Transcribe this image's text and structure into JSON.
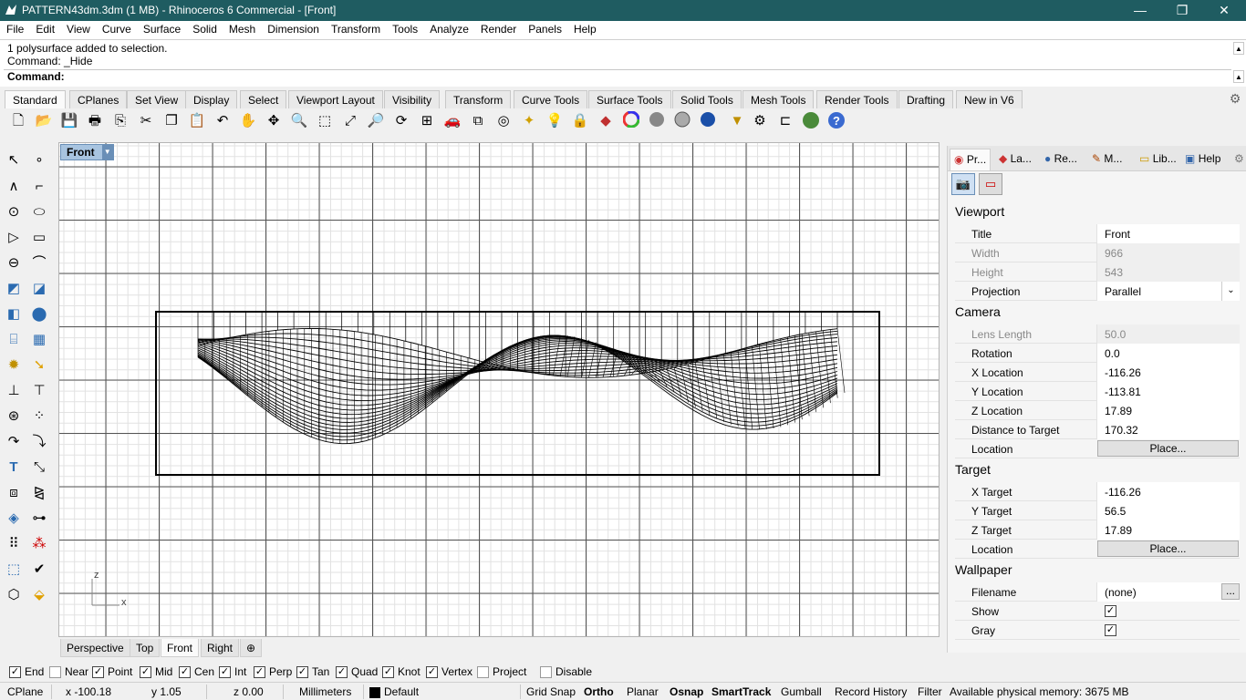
{
  "window": {
    "title": "PATTERN43dm.3dm (1 MB) - Rhinoceros 6 Commercial - [Front]",
    "controls": [
      "—",
      "❐",
      "✕"
    ]
  },
  "menu": [
    "File",
    "Edit",
    "View",
    "Curve",
    "Surface",
    "Solid",
    "Mesh",
    "Dimension",
    "Transform",
    "Tools",
    "Analyze",
    "Render",
    "Panels",
    "Help"
  ],
  "command": {
    "history": [
      "1 polysurface added to selection.",
      "Command: _Hide"
    ],
    "prompt": "Command:"
  },
  "toolbar_tabs": [
    "Standard",
    "CPlanes",
    "Set View",
    "Display",
    "Select",
    "Viewport Layout",
    "Visibility",
    "Transform",
    "Curve Tools",
    "Surface Tools",
    "Solid Tools",
    "Mesh Tools",
    "Render Tools",
    "Drafting",
    "New in V6"
  ],
  "toolbar_icons": [
    "new-file-icon",
    "open-folder-icon",
    "save-icon",
    "print-icon",
    "import-icon",
    "cut-icon",
    "copy-icon",
    "paste-icon",
    "undo-icon",
    "pan-hand-icon",
    "rotate-view-icon",
    "zoom-icon",
    "zoom-window-icon",
    "zoom-extents-icon",
    "zoom-selected-icon",
    "rotate-camera-icon",
    "four-viewports-icon",
    "car-icon",
    "layer-icon",
    "circle-target-icon",
    "lights-icon",
    "bulb-icon",
    "lock-icon",
    "layer-color-icon",
    "color-wheel-icon",
    "sphere-gray-icon",
    "sphere-shaded-icon",
    "sphere-dark-icon",
    "sphere-blue-icon",
    "filter-icon",
    "gears-icon",
    "dimension-icon",
    "render-globe-icon",
    "help-icon"
  ],
  "viewport": {
    "name": "Front",
    "axis_x": "x",
    "axis_z": "z"
  },
  "viewport_tabs": [
    "Perspective",
    "Top",
    "Front",
    "Right",
    "⊕"
  ],
  "right_panel": {
    "tabs": [
      "Pr...",
      "La...",
      "Re...",
      "M...",
      "Lib...",
      "Help"
    ],
    "sections": {
      "viewport_header": "Viewport",
      "camera_header": "Camera",
      "target_header": "Target",
      "wallpaper_header": "Wallpaper"
    },
    "viewport": {
      "title_label": "Title",
      "title_value": "Front",
      "width_label": "Width",
      "width_value": "966",
      "height_label": "Height",
      "height_value": "543",
      "projection_label": "Projection",
      "projection_value": "Parallel"
    },
    "camera": {
      "lens_label": "Lens Length",
      "lens_value": "50.0",
      "rotation_label": "Rotation",
      "rotation_value": "0.0",
      "xloc_label": "X Location",
      "xloc_value": "-116.26",
      "yloc_label": "Y Location",
      "yloc_value": "-113.81",
      "zloc_label": "Z Location",
      "zloc_value": "17.89",
      "dist_label": "Distance to Target",
      "dist_value": "170.32",
      "location_label": "Location",
      "location_button": "Place..."
    },
    "target": {
      "x_label": "X Target",
      "x_value": "-116.26",
      "y_label": "Y Target",
      "y_value": "56.5",
      "z_label": "Z Target",
      "z_value": "17.89",
      "location_label": "Location",
      "location_button": "Place..."
    },
    "wallpaper": {
      "filename_label": "Filename",
      "filename_value": "(none)",
      "filename_button": "...",
      "show_label": "Show",
      "show_checked": true,
      "gray_label": "Gray",
      "gray_checked": true
    }
  },
  "osnaps": [
    {
      "label": "End",
      "checked": true
    },
    {
      "label": "Near",
      "checked": false
    },
    {
      "label": "Point",
      "checked": true
    },
    {
      "label": "Mid",
      "checked": true
    },
    {
      "label": "Cen",
      "checked": true
    },
    {
      "label": "Int",
      "checked": true
    },
    {
      "label": "Perp",
      "checked": true
    },
    {
      "label": "Tan",
      "checked": true
    },
    {
      "label": "Quad",
      "checked": true
    },
    {
      "label": "Knot",
      "checked": true
    },
    {
      "label": "Vertex",
      "checked": true
    },
    {
      "label": "Project",
      "checked": false
    },
    {
      "label": "Disable",
      "checked": false
    }
  ],
  "status": {
    "cplane": "CPlane",
    "x": "x -100.18",
    "y": "y 1.05",
    "z": "z 0.00",
    "units": "Millimeters",
    "layer": "Default",
    "grid_snap": "Grid Snap",
    "ortho": "Ortho",
    "planar": "Planar",
    "osnap": "Osnap",
    "smarttrack": "SmartTrack",
    "gumball": "Gumball",
    "record_history": "Record History",
    "filter": "Filter",
    "memory": "Available physical memory: 3675 MB"
  },
  "colors": {
    "titlebar": "#1f5c61",
    "viewport_label": "#a8c4e0"
  }
}
